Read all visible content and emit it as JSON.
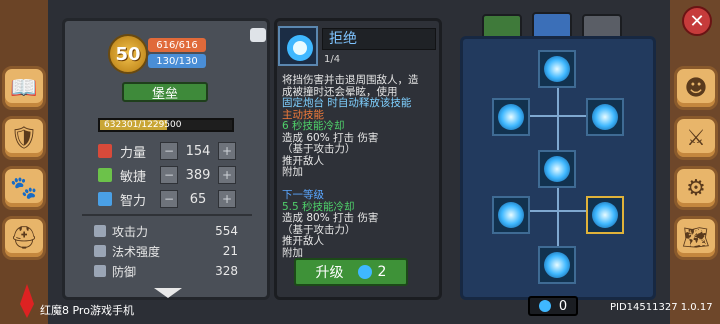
{
  "player": {
    "level": "50",
    "hp": "616/616",
    "mp": "130/130",
    "title": "堡垒",
    "xp_text": "632301/1229500",
    "xp_fraction": 0.51
  },
  "stats": [
    {
      "name": "力量",
      "value": "154",
      "icon": "strength-icon",
      "color": "#d84a3a"
    },
    {
      "name": "敏捷",
      "value": "389",
      "icon": "dagger-icon",
      "color": "#6cc24a"
    },
    {
      "name": "智力",
      "value": "65",
      "icon": "book-icon",
      "color": "#4aa0e6"
    }
  ],
  "combat": [
    {
      "name": "攻击力",
      "value": "554",
      "icon": "sword-icon"
    },
    {
      "name": "法术强度",
      "value": "21",
      "icon": "wand-icon"
    },
    {
      "name": "防御",
      "value": "328",
      "icon": "shield-icon"
    }
  ],
  "skill": {
    "name": "拒绝",
    "level": "1/4",
    "desc_lines": [
      {
        "t": "将挡伤害并击退周围敌人，造",
        "c": "#e6e6e6"
      },
      {
        "t": "成被撞时还会晕眩，使用",
        "c": "#e6e6e6"
      },
      {
        "t": "固定炮台 时自动释放该技能",
        "c": "#7fd0ff"
      },
      {
        "t": "主动技能",
        "c": "#f07a3a"
      },
      {
        "t": "6 秒技能冷却",
        "c": "#4fd06a"
      },
      {
        "t": "造成 60% 打击 伤害",
        "c": "#e6e6e6"
      },
      {
        "t": "（基于攻击力）",
        "c": "#e6e6e6"
      },
      {
        "t": "推开敌人",
        "c": "#e6e6e6"
      },
      {
        "t": "附加",
        "c": "#e6e6e6"
      },
      {
        "t": "",
        "c": "#e6e6e6"
      },
      {
        "t": "下一等级",
        "c": "#5aa6ff"
      },
      {
        "t": "5.5 秒技能冷却",
        "c": "#4fd06a"
      },
      {
        "t": "造成 80% 打击 伤害",
        "c": "#e6e6e6"
      },
      {
        "t": "（基于攻击力）",
        "c": "#e6e6e6"
      },
      {
        "t": "推开敌人",
        "c": "#e6e6e6"
      },
      {
        "t": "附加",
        "c": "#e6e6e6"
      }
    ],
    "upgrade_label": "升级",
    "upgrade_cost": "2"
  },
  "tree": {
    "points": "0"
  },
  "footer": {
    "phone_label": "红魔8 Pro游戏手机",
    "pid": "PID14511327 1.0.17"
  },
  "colors": {
    "accent": "#3fb8ff",
    "upgrade_green": "#3e9238"
  }
}
